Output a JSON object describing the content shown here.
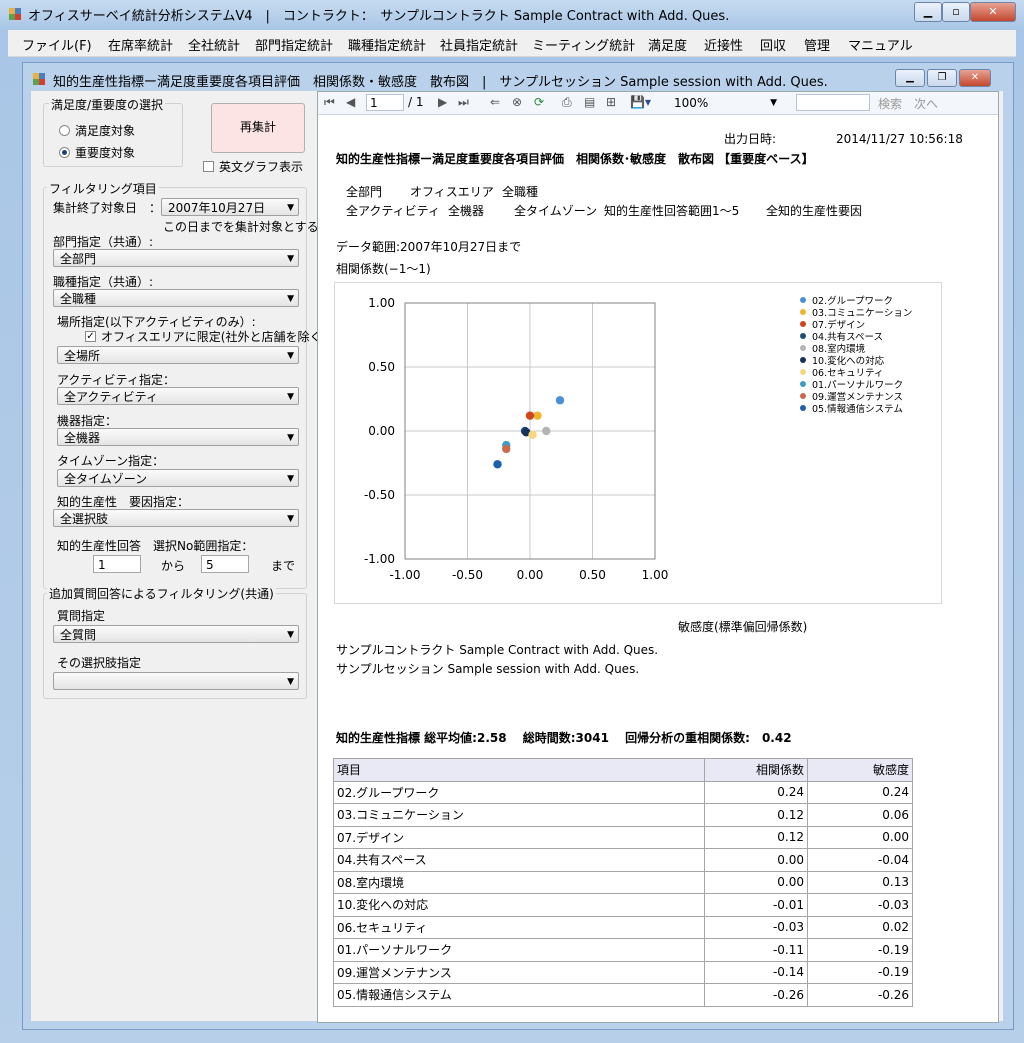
{
  "app": {
    "title": "オフィスサーベイ統計分析システムV4　|　コントラクト：　サンプルコントラクト Sample Contract with Add. Ques.",
    "menu": [
      "ファイル(F)",
      "在席率統計",
      "全社統計",
      "部門指定統計",
      "職種指定統計",
      "社員指定統計",
      "ミーティング統計",
      "満足度",
      "近接性",
      "回収",
      "管理",
      "マニュアル"
    ]
  },
  "window": {
    "title": "知的生産性指標ー満足度重要度各項目評価　相関係数・敏感度　散布図　|　サンプルセッション Sample session with Add. Ques."
  },
  "left": {
    "selection_group": "満足度/重要度の選択",
    "radio_satisfaction": "満足度対象",
    "radio_importance": "重要度対象",
    "selected": "importance",
    "recalc_button": "再集計",
    "english_graph": "英文グラフ表示",
    "filter_group": "フィルタリング項目",
    "end_date_label": "集計終了対象日　：",
    "end_date_value": "2007年10月27日",
    "end_date_note": "この日までを集計対象とする",
    "dept_label": "部門指定（共通）:",
    "dept_value": "全部門",
    "job_label": "職種指定（共通）:",
    "job_value": "全職種",
    "place_label": "場所指定(以下アクティビティのみ）:",
    "office_only": "オフィスエリアに限定(社外と店舗を除く)",
    "place_value": "全場所",
    "activity_label": "アクティビティ指定：",
    "activity_value": "全アクティビティ",
    "device_label": "機器指定：",
    "device_value": "全機器",
    "timezone_label": "タイムゾーン指定：",
    "timezone_value": "全タイムゾーン",
    "factor_label": "知的生産性　要因指定：",
    "factor_value": "全選択肢",
    "range_label": "知的生産性回答　選択No範囲指定：",
    "range_from": "1",
    "range_from_text": "から",
    "range_to": "5",
    "range_to_text": "まで",
    "add_group": "追加質問回答によるフィルタリング(共通)",
    "question_label": "質問指定",
    "question_value": "全質問",
    "choice_label": "その選択肢指定",
    "choice_value": ""
  },
  "toolbar": {
    "page": "1",
    "of": "/ 1",
    "zoom": "100%",
    "search": "検索",
    "next": "次へ"
  },
  "report": {
    "output_label": "出力日時:",
    "output_time": "2014/11/27 10:56:18",
    "title": "知的生産性指標ー満足度重要度各項目評価　相関係数･敏感度　散布図 【重要度ベース】",
    "filters_line1": [
      "全部門",
      "オフィスエリア",
      "全職種"
    ],
    "filters_line2": [
      "全アクティビティ",
      "全機器",
      "全タイムゾーン",
      "知的生産性回答範囲1～5",
      "全知的生産性要因"
    ],
    "data_range": "データ範囲:2007年10月27日まで",
    "y_title": "相関係数(−1～1)",
    "x_title": "敏感度(標準偏回帰係数)",
    "contract": "サンプルコントラクト Sample Contract with Add. Ques.",
    "session": "サンプルセッション Sample session with Add. Ques.",
    "summary": "知的生産性指標 総平均値:2.58　 総時間数:3041　 回帰分析の重相関係数:　0.42",
    "table_headers": [
      "項目",
      "相関係数",
      "敏感度"
    ]
  },
  "chart_data": {
    "type": "scatter",
    "xlabel": "敏感度(標準偏回帰係数)",
    "ylabel": "相関係数(−1～1)",
    "xlim": [
      -1.0,
      1.0
    ],
    "ylim": [
      -1.0,
      1.0
    ],
    "xticks": [
      "-1.00",
      "-0.50",
      "0.00",
      "0.50",
      "1.00"
    ],
    "yticks": [
      "1.00",
      "0.50",
      "0.00",
      "-0.50",
      "-1.00"
    ],
    "grid": true,
    "legend": "right",
    "series": [
      {
        "name": "02.グループワーク",
        "x": 0.24,
        "y": 0.24,
        "color": "#4a90d9"
      },
      {
        "name": "03.コミュニケーション",
        "x": 0.06,
        "y": 0.12,
        "color": "#f0b330"
      },
      {
        "name": "07.デザイン",
        "x": 0.0,
        "y": 0.12,
        "color": "#d2461e"
      },
      {
        "name": "04.共有スペース",
        "x": -0.04,
        "y": 0.0,
        "color": "#1f4e79"
      },
      {
        "name": "08.室内環境",
        "x": 0.13,
        "y": 0.0,
        "color": "#b4b4b4"
      },
      {
        "name": "10.変化への対応",
        "x": -0.03,
        "y": -0.01,
        "color": "#14325a"
      },
      {
        "name": "06.セキュリティ",
        "x": 0.02,
        "y": -0.03,
        "color": "#f8d77c"
      },
      {
        "name": "01.パーソナルワーク",
        "x": -0.19,
        "y": -0.11,
        "color": "#3a9fc4"
      },
      {
        "name": "09.運営メンテナンス",
        "x": -0.19,
        "y": -0.14,
        "color": "#c96a4c"
      },
      {
        "name": "05.情報通信システム",
        "x": -0.26,
        "y": -0.26,
        "color": "#1b5fb0"
      }
    ]
  },
  "table_rows": [
    [
      "02.グループワーク",
      "0.24",
      "0.24"
    ],
    [
      "03.コミュニケーション",
      "0.12",
      "0.06"
    ],
    [
      "07.デザイン",
      "0.12",
      "0.00"
    ],
    [
      "04.共有スペース",
      "0.00",
      "-0.04"
    ],
    [
      "08.室内環境",
      "0.00",
      "0.13"
    ],
    [
      "10.変化への対応",
      "-0.01",
      "-0.03"
    ],
    [
      "06.セキュリティ",
      "-0.03",
      "0.02"
    ],
    [
      "01.パーソナルワーク",
      "-0.11",
      "-0.19"
    ],
    [
      "09.運営メンテナンス",
      "-0.14",
      "-0.19"
    ],
    [
      "05.情報通信システム",
      "-0.26",
      "-0.26"
    ]
  ]
}
